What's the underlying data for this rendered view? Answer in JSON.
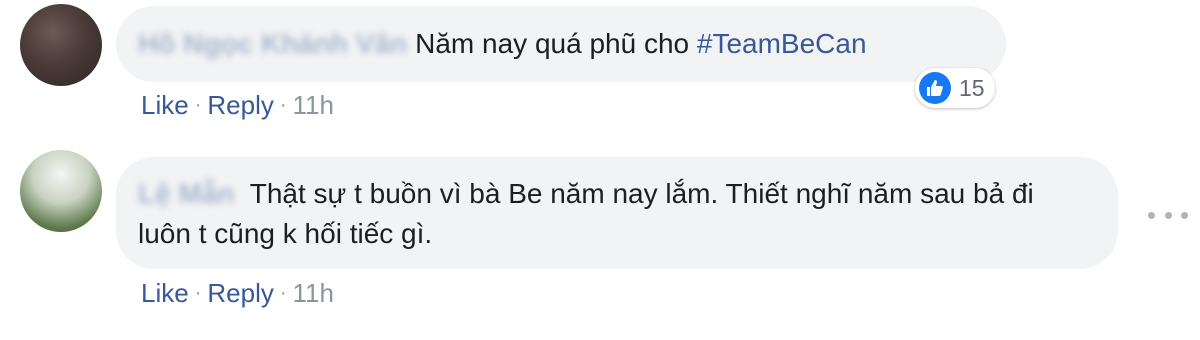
{
  "comments": [
    {
      "author": "Hồ Ngọc Khánh Vân",
      "text": "Năm nay quá phũ cho ",
      "hashtag": "#TeamBeCan",
      "like_label": "Like",
      "reply_label": "Reply",
      "time": "11h",
      "reaction_count": "15"
    },
    {
      "author": "Lệ Mẫn",
      "text": "Thật sự t buồn vì bà Be năm nay lắm. Thiết nghĩ năm sau bả đi luôn t cũng k hối tiếc gì.",
      "like_label": "Like",
      "reply_label": "Reply",
      "time": "11h"
    }
  ],
  "separator": "·",
  "icons": {
    "like": "thumbs-up-icon",
    "more": "more-options-icon"
  },
  "colors": {
    "link": "#385898",
    "bubble": "#f2f3f5",
    "like_badge": "#1877f2"
  }
}
